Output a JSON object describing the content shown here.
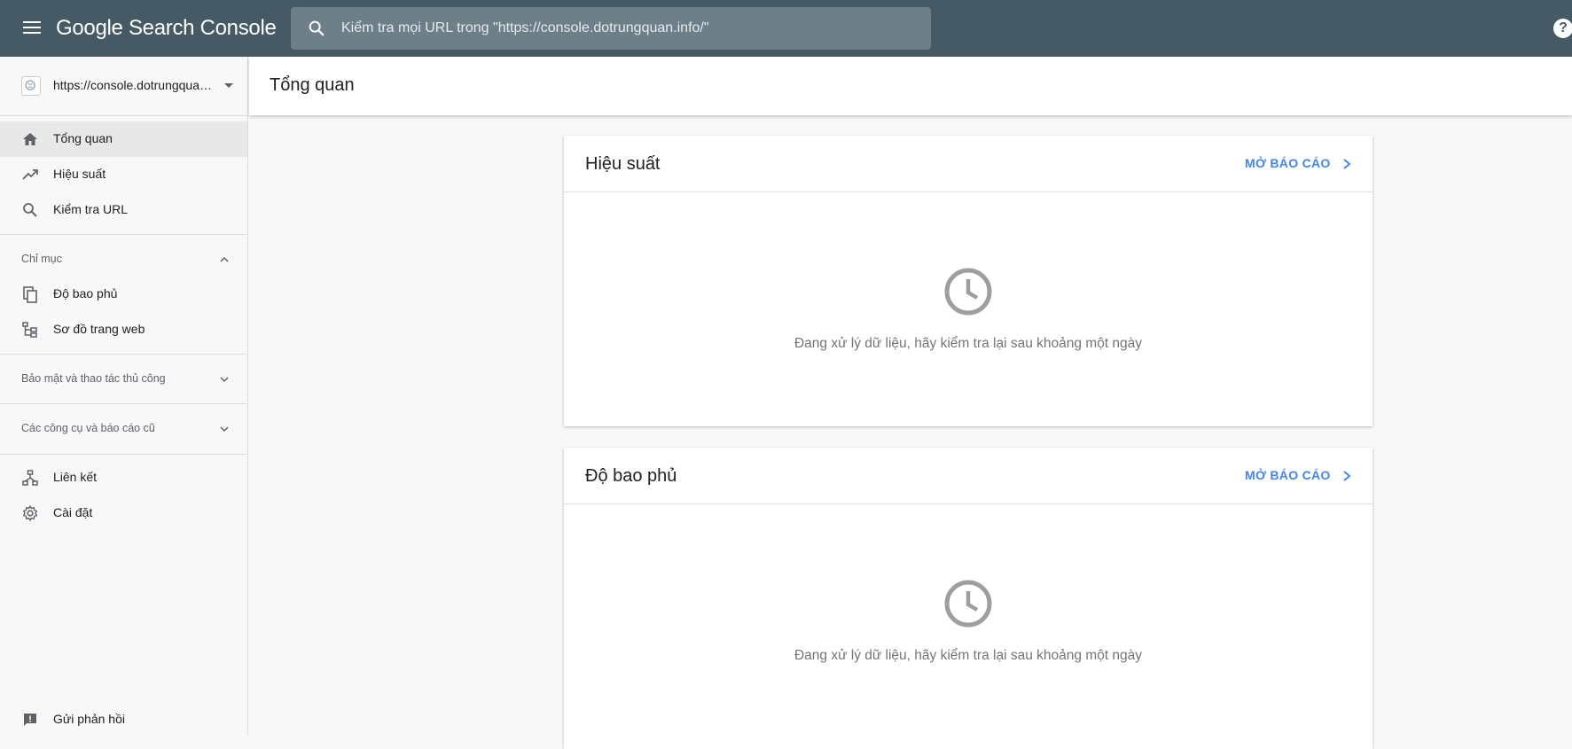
{
  "app": {
    "title": "Google Search Console"
  },
  "search": {
    "placeholder": "Kiểm tra mọi URL trong \"https://console.dotrungquan.info/\""
  },
  "property": {
    "label": "https://console.dotrungquan.info/"
  },
  "sidebar": {
    "items": [
      {
        "label": "Tổng quan",
        "icon": "home-icon",
        "active": true
      },
      {
        "label": "Hiệu suất",
        "icon": "trending-up-icon"
      },
      {
        "label": "Kiểm tra URL",
        "icon": "search-icon"
      }
    ],
    "index_section": {
      "label": "Chỉ mục",
      "expanded": true,
      "items": [
        {
          "label": "Độ bao phủ",
          "icon": "copy-pages-icon"
        },
        {
          "label": "Sơ đồ trang web",
          "icon": "sitemap-icon"
        }
      ]
    },
    "security_section": {
      "label": "Bảo mật và thao tác thủ công",
      "expanded": false
    },
    "legacy_section": {
      "label": "Các công cụ và báo cáo cũ",
      "expanded": false
    },
    "links": {
      "label": "Liên kết",
      "icon": "links-icon"
    },
    "settings": {
      "label": "Cài đặt",
      "icon": "gear-icon"
    },
    "feedback": {
      "label": "Gửi phản hồi",
      "icon": "feedback-icon"
    }
  },
  "main": {
    "title": "Tổng quan",
    "cards": [
      {
        "title": "Hiệu suất",
        "link": "MỞ BÁO CÁO",
        "message": "Đang xử lý dữ liệu, hãy kiểm tra lại sau khoảng một ngày"
      },
      {
        "title": "Độ bao phủ",
        "link": "MỞ BÁO CÁO",
        "message": "Đang xử lý dữ liệu, hãy kiểm tra lại sau khoảng một ngày"
      }
    ]
  },
  "colors": {
    "topbar": "#455a64",
    "link": "#4285f4",
    "accent_icon": "#9e9e9e"
  }
}
